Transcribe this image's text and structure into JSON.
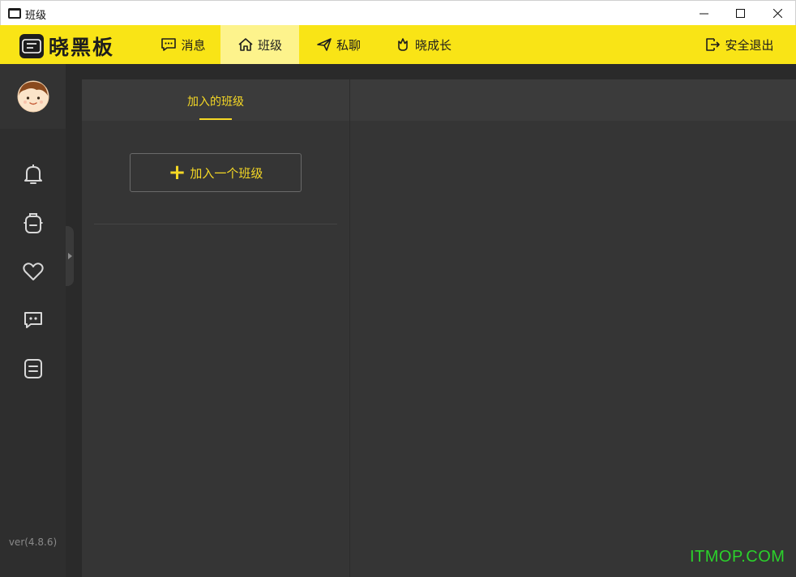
{
  "window": {
    "title": "班级"
  },
  "header": {
    "logo_text": "晓黑板",
    "nav": [
      {
        "label": "消息",
        "icon": "message-icon"
      },
      {
        "label": "班级",
        "icon": "home-icon",
        "active": true
      },
      {
        "label": "私聊",
        "icon": "send-icon"
      },
      {
        "label": "晓成长",
        "icon": "growth-icon"
      }
    ],
    "logout_label": "安全退出"
  },
  "sidebar": {
    "icons": [
      "bell-icon",
      "backpack-icon",
      "heart-icon",
      "chat-bubble-icon",
      "notes-icon"
    ],
    "version": "ver(4.8.6)"
  },
  "classes": {
    "tab_label": "加入的班级",
    "join_button_label": "加入一个班级"
  },
  "watermark": "ITMOP.COM",
  "colors": {
    "accent_yellow": "#f9e416",
    "active_nav": "#fdf38c",
    "panel_bg": "#353535",
    "text_yellow": "#f5d825"
  }
}
